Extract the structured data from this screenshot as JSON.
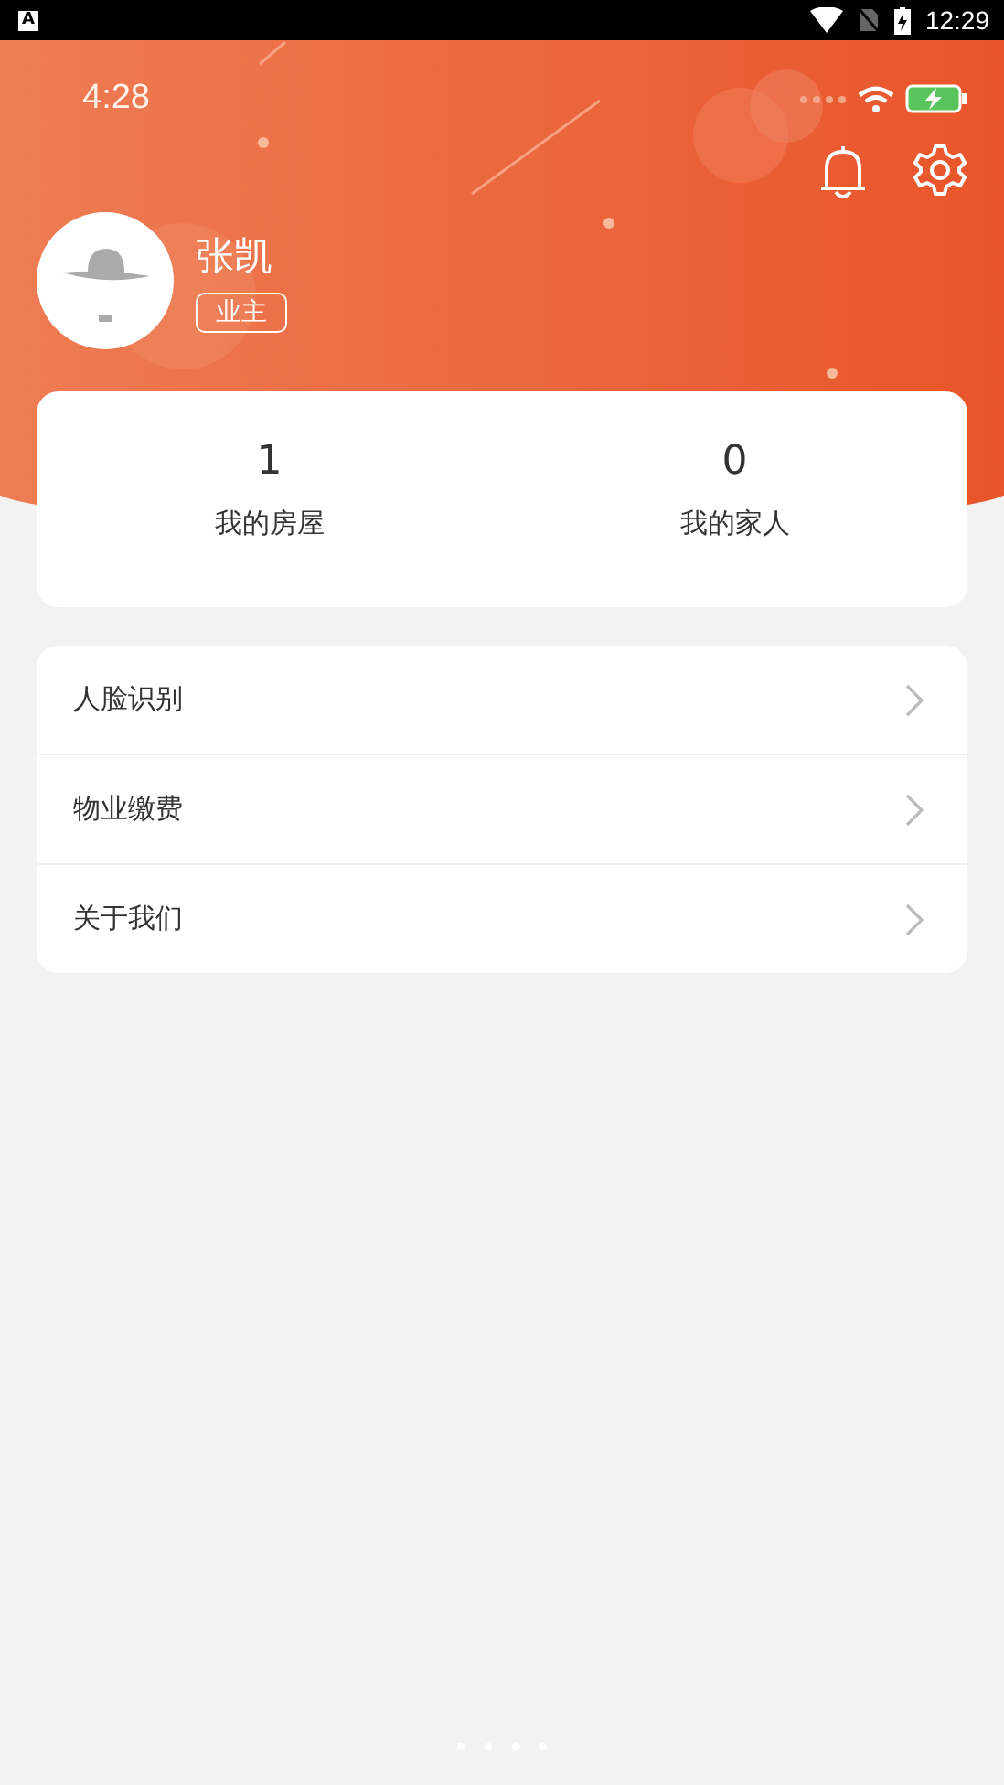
{
  "system_status_bar": {
    "notification_letter": "A",
    "time": "12:29"
  },
  "app_status_bar": {
    "time": "4:28"
  },
  "profile": {
    "name": "张凯",
    "role": "业主"
  },
  "stats": [
    {
      "value": "1",
      "label": "我的房屋"
    },
    {
      "value": "0",
      "label": "我的家人"
    }
  ],
  "menu": [
    {
      "label": "人脸识别"
    },
    {
      "label": "物业缴费"
    },
    {
      "label": "关于我们"
    }
  ]
}
